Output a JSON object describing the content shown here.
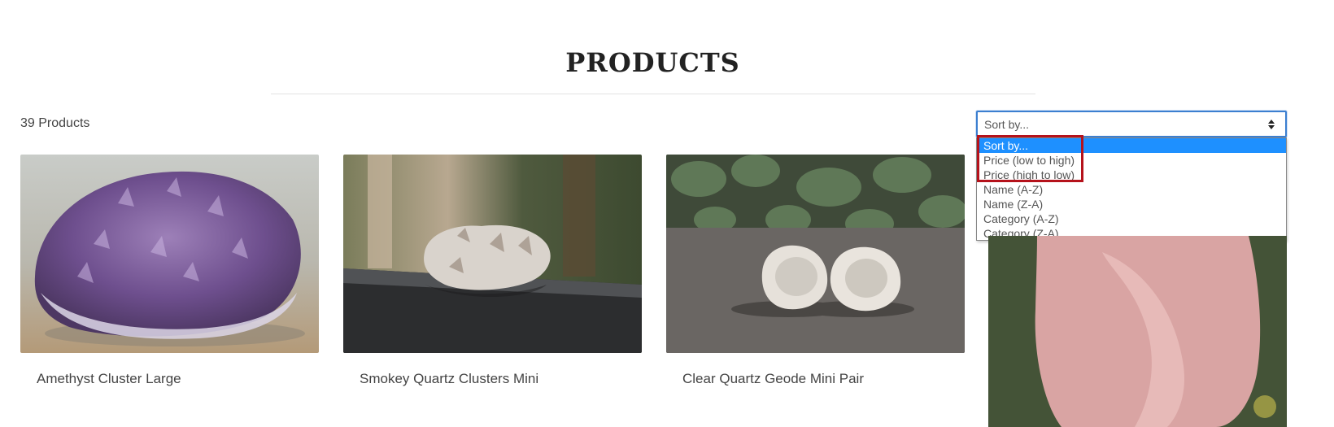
{
  "page": {
    "title": "PRODUCTS"
  },
  "catalog": {
    "count_label": "39 Products"
  },
  "sort": {
    "current_value": "Sort by...",
    "options": [
      {
        "label": "Sort by...",
        "selected": true
      },
      {
        "label": "Price (low to high)"
      },
      {
        "label": "Price (high to low)"
      },
      {
        "label": "Name (A-Z)"
      },
      {
        "label": "Name (Z-A)"
      },
      {
        "label": "Category (A-Z)"
      },
      {
        "label": "Category (Z-A)"
      }
    ],
    "highlight_color": "#b5121b",
    "accent_color": "#1e90ff"
  },
  "products": [
    {
      "name": "Amethyst Cluster Large"
    },
    {
      "name": "Smokey Quartz Clusters Mini"
    },
    {
      "name": "Clear Quartz Geode Mini Pair"
    }
  ]
}
